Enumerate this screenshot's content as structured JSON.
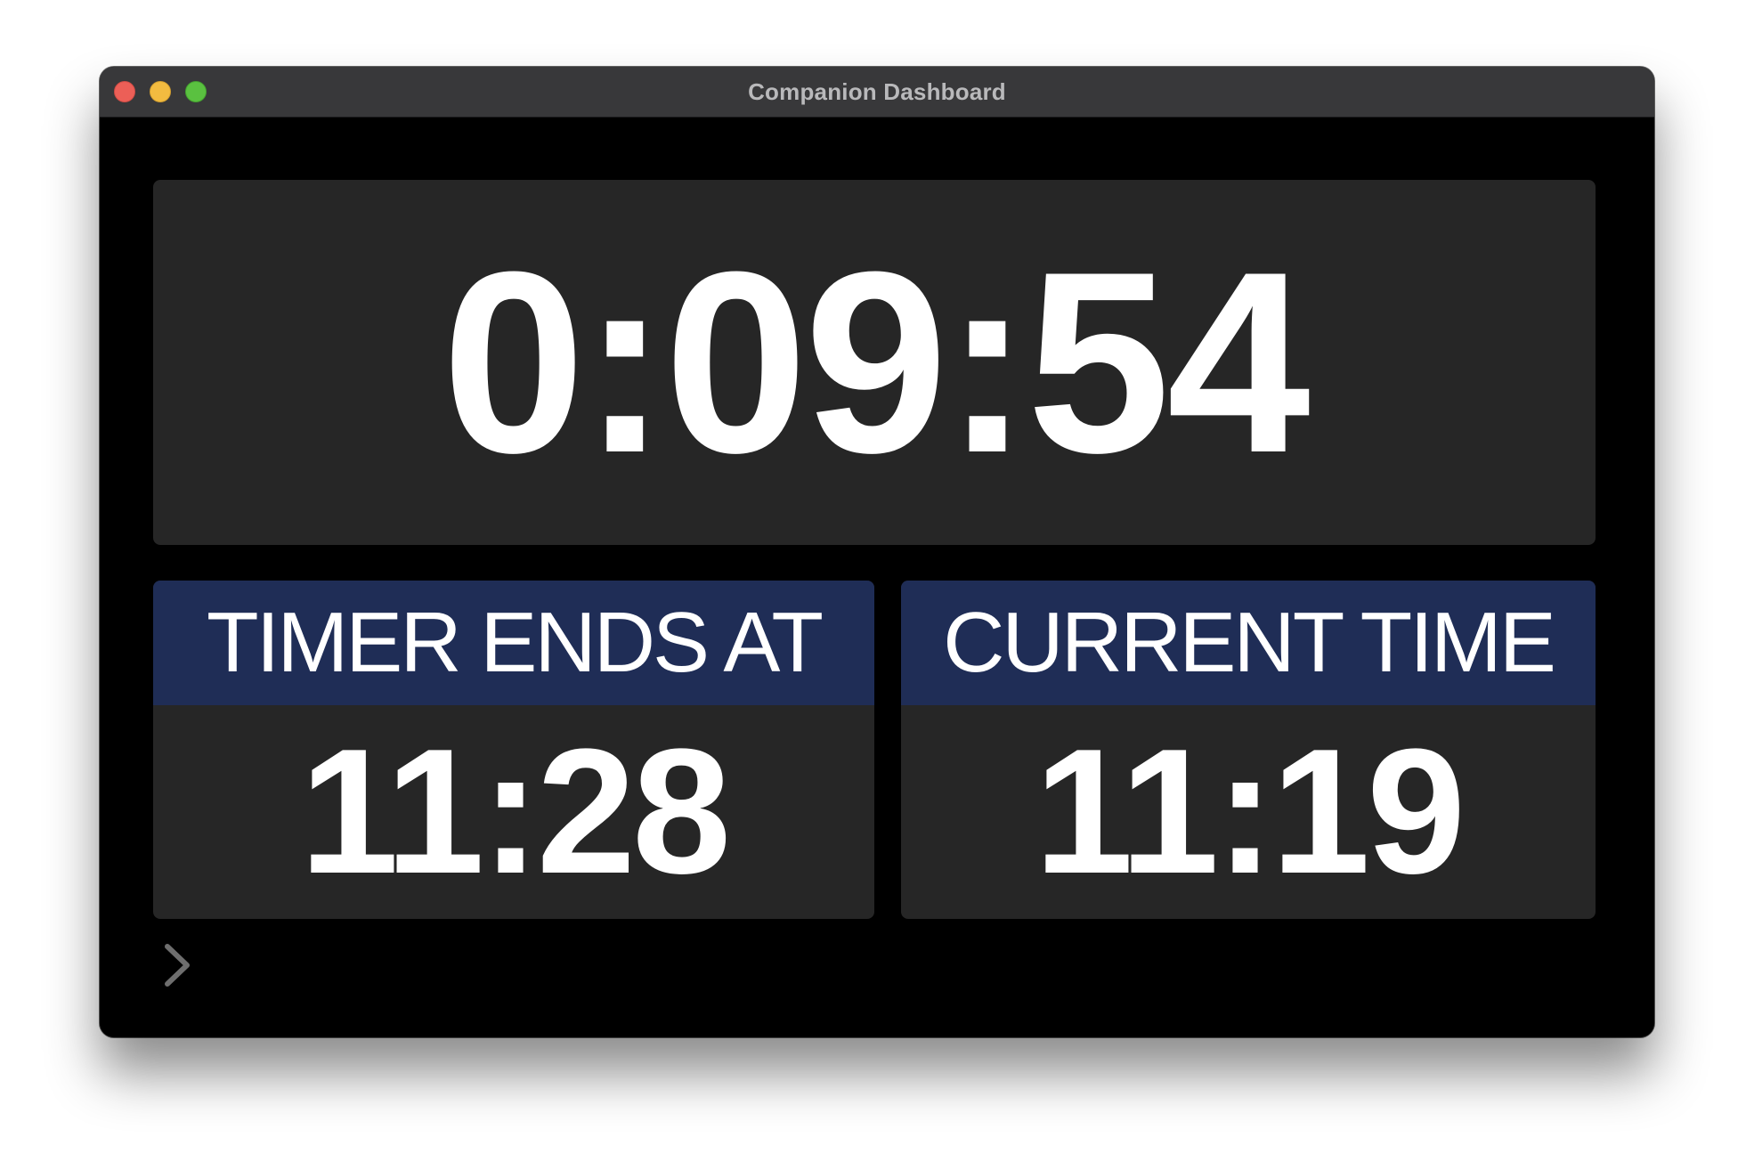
{
  "window": {
    "title": "Companion Dashboard"
  },
  "timer": {
    "value": "0:09:54"
  },
  "timer_ends": {
    "label": "TIMER ENDS AT",
    "value": "11:28"
  },
  "current_time": {
    "label": "CURRENT TIME",
    "value": "11:19"
  },
  "icons": {
    "expand": "chevron-right-icon"
  },
  "colors": {
    "header_bg": "#1f2d56",
    "panel_bg": "#262626",
    "window_bg": "#000000"
  }
}
